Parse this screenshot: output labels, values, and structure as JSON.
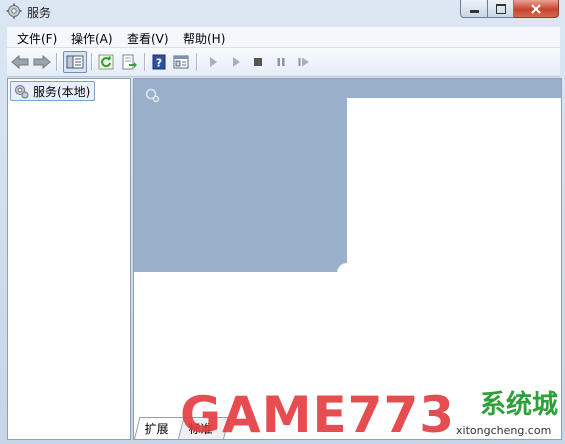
{
  "window": {
    "title": "服务"
  },
  "caption_buttons": {
    "minimize": "—",
    "maximize": "☐",
    "close": "✕"
  },
  "menu": {
    "items": [
      "文件(F)",
      "操作(A)",
      "查看(V)",
      "帮助(H)"
    ]
  },
  "toolbar": {
    "icons": [
      "back-arrow-icon",
      "forward-arrow-icon",
      "show-hide-tree-icon",
      "refresh-icon",
      "export-list-icon",
      "help-icon",
      "properties-icon",
      "start-service-icon",
      "start-service-alt-icon",
      "stop-service-icon",
      "pause-service-icon",
      "restart-service-icon"
    ]
  },
  "tree": {
    "selected_label": "服务(本地)"
  },
  "tabs": {
    "extended": "扩展",
    "standard": "标准"
  },
  "watermark": {
    "brand": "GAME773",
    "cn": "系统城",
    "site": "xitongcheng.com"
  },
  "colors": {
    "banner": "#9ab1cc",
    "accent": "#e43a3e"
  }
}
